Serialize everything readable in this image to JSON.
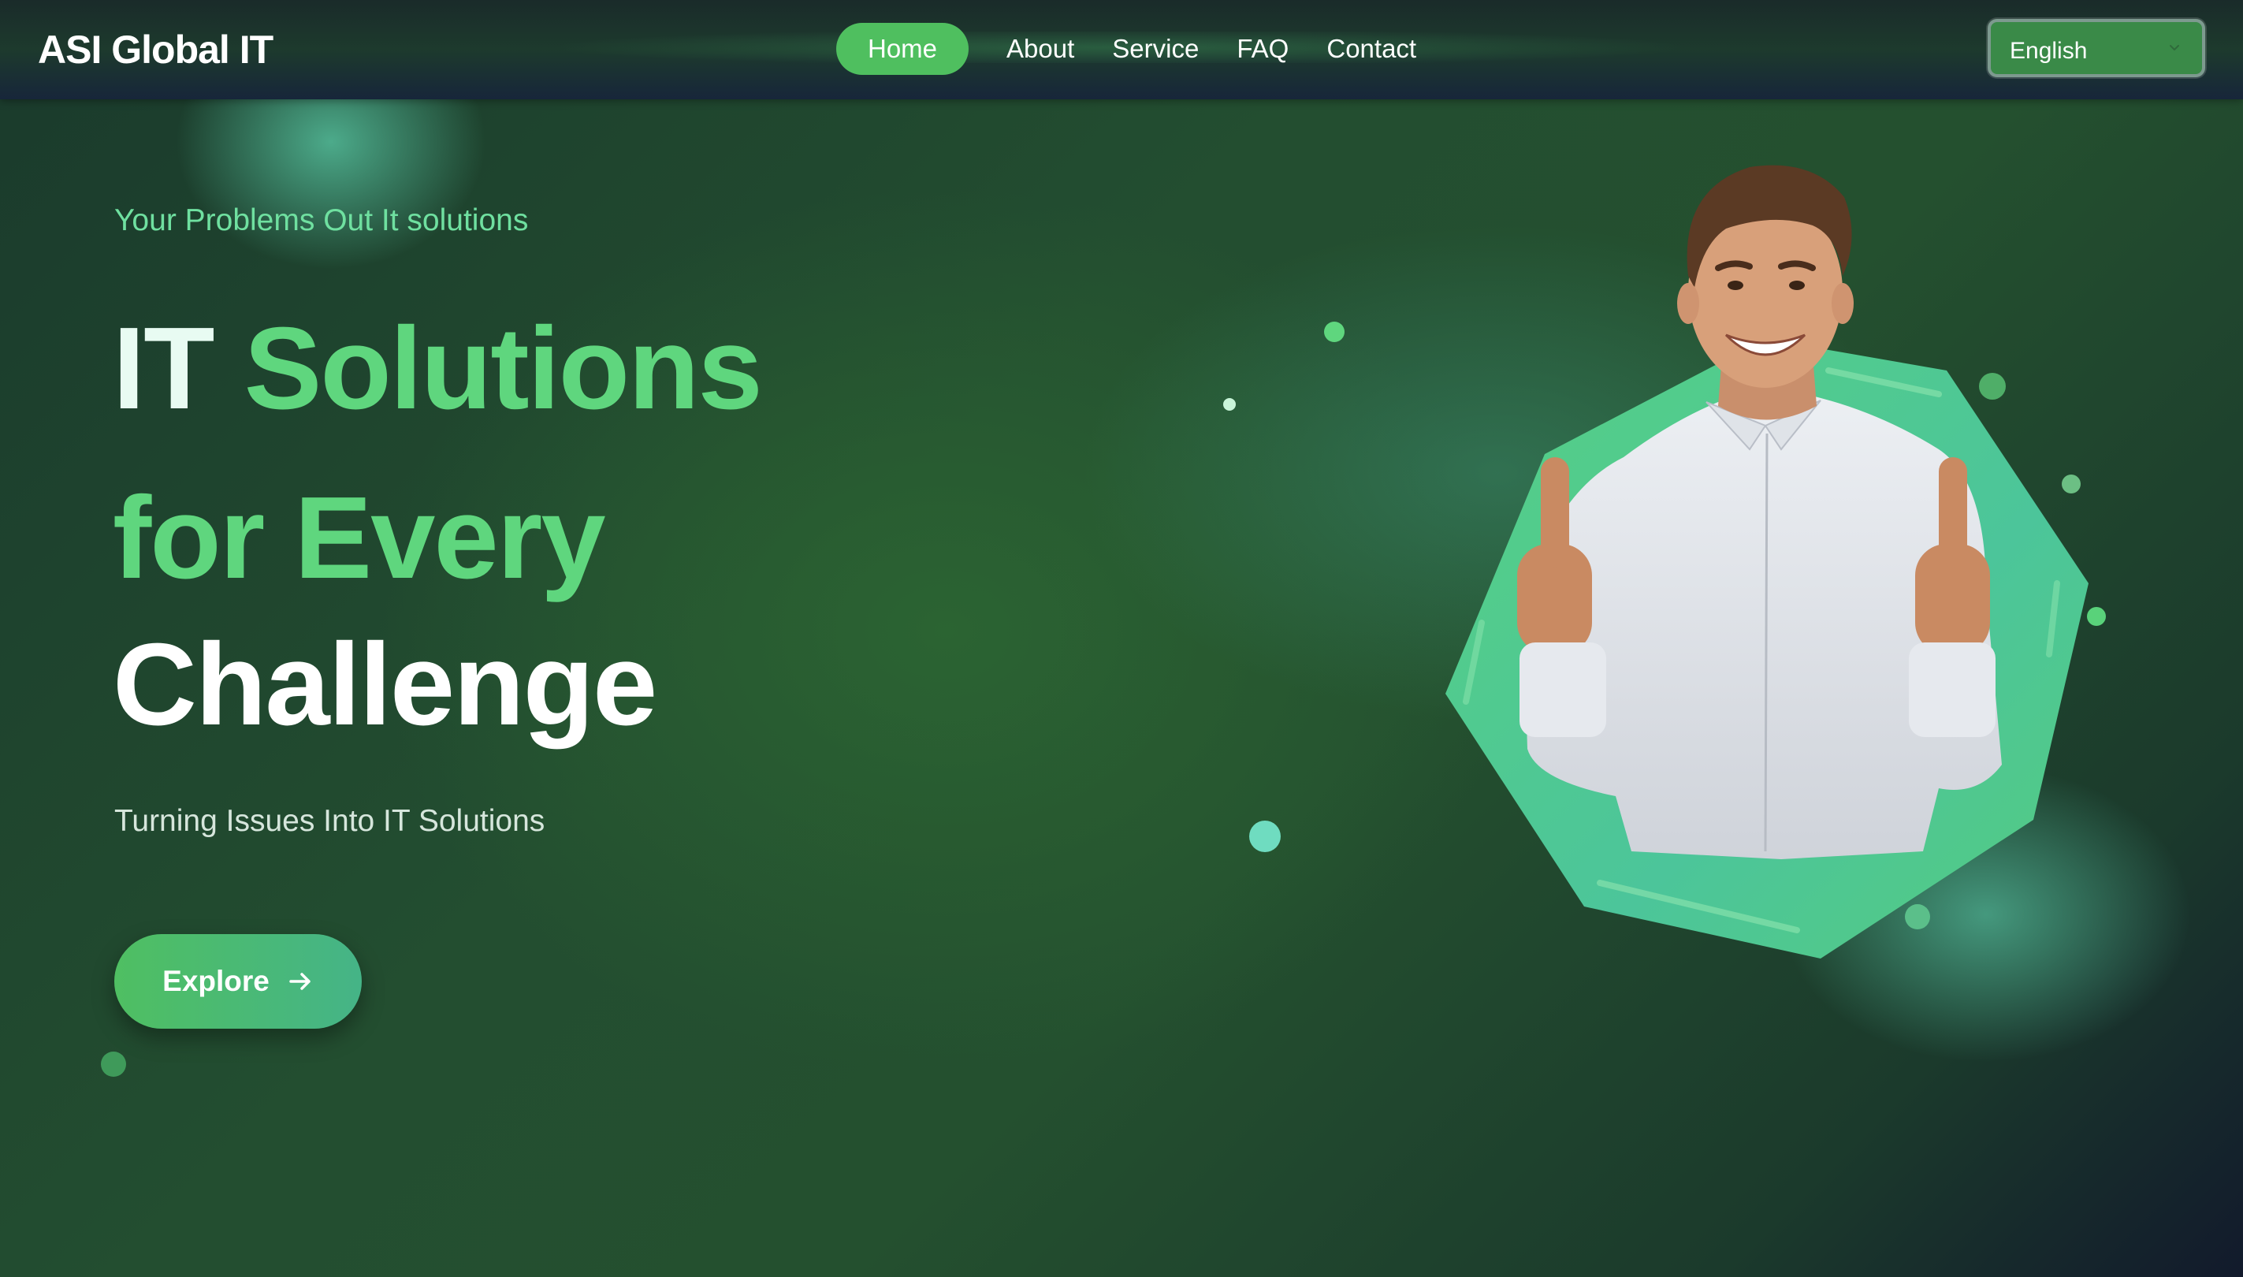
{
  "header": {
    "logo": "ASI Global IT",
    "nav": [
      {
        "label": "Home",
        "active": true
      },
      {
        "label": "About",
        "active": false
      },
      {
        "label": "Service",
        "active": false
      },
      {
        "label": "FAQ",
        "active": false
      },
      {
        "label": "Contact",
        "active": false
      }
    ],
    "language": {
      "selected": "English",
      "icon": "chevron-down-icon"
    }
  },
  "hero": {
    "tagline": "Your Problems Out It solutions",
    "headline": {
      "line1_a": "IT",
      "line1_b": "Solutions",
      "line2": "for Every",
      "line3": "Challenge"
    },
    "subtitle": "Turning Issues Into IT Solutions",
    "cta": {
      "label": "Explore",
      "icon": "arrow-right-icon"
    },
    "image": {
      "subject": "smiling man in white shirt giving two thumbs up",
      "icon": "hexagon-backdrop"
    }
  },
  "colors": {
    "accent": "#5fd67e",
    "nav_active": "#4fbf5f",
    "tagline": "#6fe0a0",
    "background_dark": "#1d3d2b"
  }
}
